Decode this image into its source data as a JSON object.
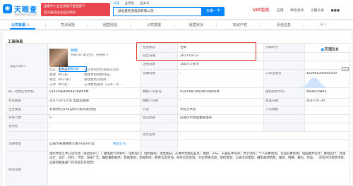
{
  "header": {
    "logo": {
      "name": "天眼查",
      "url": "TianYanCha.com"
    },
    "banner": {
      "line1": "国家中小企业发展子基金旗下",
      "line2": "官方备案企业征信机构"
    },
    "search_tabs": [
      "公司",
      "查老板",
      "查关系"
    ],
    "search_value": "湖北墨色泡电商有限公司",
    "search_button": "天眼一下",
    "vip_label": "VIP会员",
    "nav": [
      "应用",
      "商务合作",
      "天眼头条",
      "●●●"
    ]
  },
  "tabs": [
    {
      "label": "公司背景",
      "count": "16"
    },
    {
      "label": "司法风险",
      "count": ""
    },
    {
      "label": "经营风险",
      "count": ""
    },
    {
      "label": "公司发展",
      "count": ""
    },
    {
      "label": "经营状况",
      "count": ""
    },
    {
      "label": "知识产权",
      "count": ""
    },
    {
      "label": "历史信息",
      "count": ""
    },
    {
      "label": "⊡",
      "count": "2"
    }
  ],
  "section_title": "工商信息",
  "favorite_label": "天眼查存档",
  "share_icon": "up",
  "rep": {
    "label": "法定代表人",
    "name": "杨柳",
    "sub": "任职 42 家企业，分布如下",
    "regions": [
      "北京（共1家）",
      "福建（共1家）",
      "湖北（共37家）",
      "天津（共1家）"
    ],
    "notes": [
      "北京青和文化有限公司等",
      "福建青和网络科技...",
      "湖北墨色泡电商...",
      "天津墨色潮流（天津）科..."
    ],
    "count": "42"
  },
  "rows": [
    {
      "c1": "经营状态",
      "c2": "注销",
      "c3": "天眼评分",
      "c4": ""
    },
    {
      "c1": "成立日期",
      "c2": "2017-02-13",
      "c3": "",
      "c4": ""
    },
    {
      "c1": "注册资本",
      "c2": "100万人民币",
      "c3": "实缴资本",
      "c4": "-"
    },
    {
      "c1": "实缴资本",
      "c2": "-",
      "c3": "工商注册号",
      "c4": "420981000050439"
    }
  ],
  "id_row": {
    "l1": "统一社会信用代码",
    "v1": "91420981MA48TKWAXM",
    "l2": "纳税人识别号",
    "v2": "91420981MA48TKWAXM",
    "l3": "组织机构代码",
    "v3": "MA48TKWAX"
  },
  "term_row": {
    "l1": "营业期限",
    "v1": "2017-02-13 至 无固定期限",
    "l2": "纳税人资质",
    "v2": "-",
    "l3": "核准日期",
    "v3": "2021-07-20"
  },
  "type_row": {
    "l1": "企业类型",
    "v1": "有限责任公司(自然人投资或控股)",
    "l2": "行业",
    "v2": "文化艺术业",
    "l3": "人员规模",
    "v3": "-"
  },
  "ins_row": {
    "l1": "参保人数",
    "v1": "0",
    "l2": "登记机关",
    "v2": "应城市市场监督管理局"
  },
  "name_row": {
    "l1": "曾用名",
    "v1": "-",
    "l2": "英文名称",
    "v2": "-"
  },
  "addr_row": {
    "l1": "注册地址",
    "v1": "应城市黄滩镇明义路16号201室",
    "link": "附近公司"
  },
  "scope_row": {
    "l1": "经营范围",
    "v1": "组织文化艺术交流活动（演出除外）；广播电视节目制作；电影发行；电影摄制；演出经纪；从事文化经纪业务；舞台、声乐、乐器技术培训；文字创作；个人形象策划，企业形象策划；电脑图文设计；舞台设计；动漫设计；设计、制作、代理、发布广告；摄影摄影服务；影视策划；影视制作；教育信息咨询；商务信息咨询；文化传媒活动；组织策划；公关活动策划；摄影器材销售；服装、鞋帽、箱包、饰品...（涉及许可经营项目，应取得相关部门许可后方可经营）"
  },
  "score": "58",
  "colors": {
    "accent": "#0084ff",
    "highlight": "#e03a2f",
    "banner": "#e8454c"
  }
}
